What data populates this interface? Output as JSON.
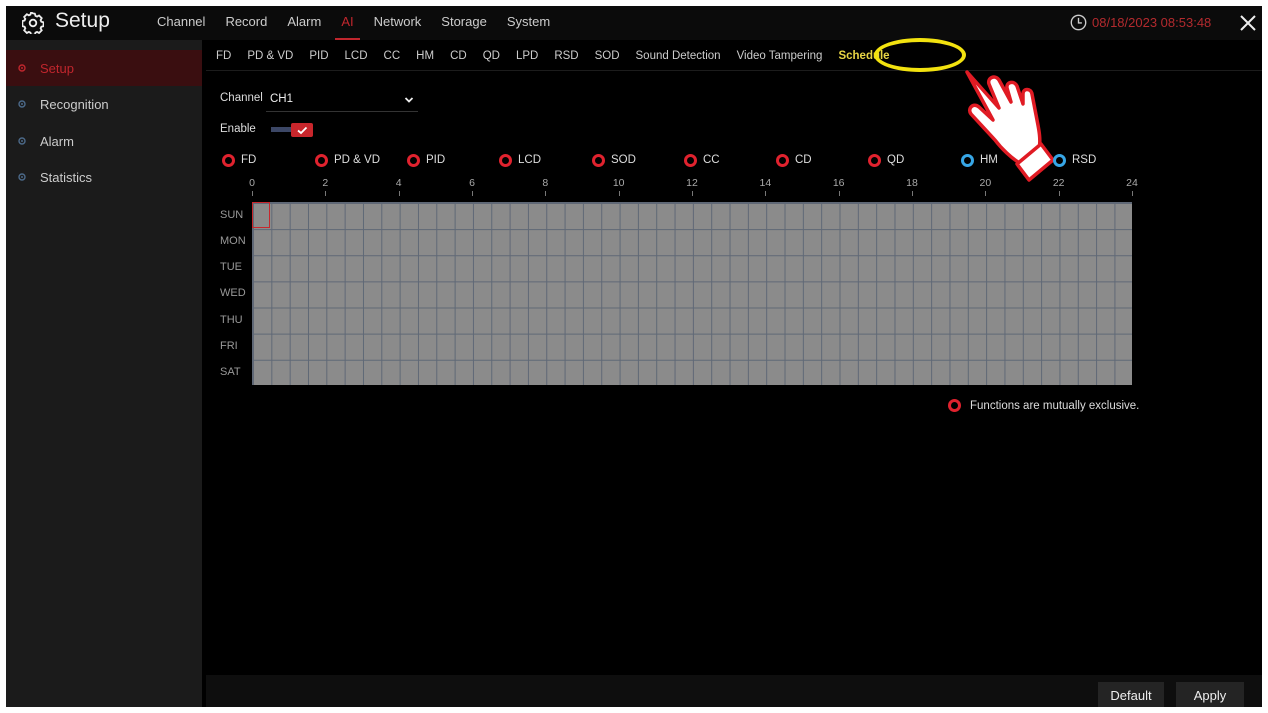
{
  "header": {
    "title": "Setup",
    "datetime": "08/18/2023 08:53:48",
    "icon": "gear-icon",
    "clock_icon": "clock-icon",
    "close_icon": "close-icon"
  },
  "topnav": [
    {
      "label": "Channel",
      "active": false
    },
    {
      "label": "Record",
      "active": false
    },
    {
      "label": "Alarm",
      "active": false
    },
    {
      "label": "AI",
      "active": true
    },
    {
      "label": "Network",
      "active": false
    },
    {
      "label": "Storage",
      "active": false
    },
    {
      "label": "System",
      "active": false
    }
  ],
  "sidebar": [
    {
      "label": "Setup",
      "active": true
    },
    {
      "label": "Recognition",
      "active": false
    },
    {
      "label": "Alarm",
      "active": false
    },
    {
      "label": "Statistics",
      "active": false
    }
  ],
  "subnav": [
    {
      "label": "FD",
      "active": false
    },
    {
      "label": "PD & VD",
      "active": false
    },
    {
      "label": "PID",
      "active": false
    },
    {
      "label": "LCD",
      "active": false
    },
    {
      "label": "CC",
      "active": false
    },
    {
      "label": "HM",
      "active": false
    },
    {
      "label": "CD",
      "active": false
    },
    {
      "label": "QD",
      "active": false
    },
    {
      "label": "LPD",
      "active": false
    },
    {
      "label": "RSD",
      "active": false
    },
    {
      "label": "SOD",
      "active": false
    },
    {
      "label": "Sound Detection",
      "active": false
    },
    {
      "label": "Video Tampering",
      "active": false
    },
    {
      "label": "Schedule",
      "active": true
    }
  ],
  "form": {
    "channel_label": "Channel",
    "channel_value": "CH1",
    "enable_label": "Enable",
    "enable_on": true
  },
  "functions": [
    {
      "label": "FD",
      "color": "#e0222e"
    },
    {
      "label": "PD & VD",
      "color": "#e0222e"
    },
    {
      "label": "PID",
      "color": "#e0222e"
    },
    {
      "label": "LCD",
      "color": "#e0222e"
    },
    {
      "label": "SOD",
      "color": "#e0222e"
    },
    {
      "label": "CC",
      "color": "#e0222e"
    },
    {
      "label": "CD",
      "color": "#e0222e"
    },
    {
      "label": "QD",
      "color": "#e0222e"
    },
    {
      "label": "HM",
      "color": "#37a6e6"
    },
    {
      "label": "RSD",
      "color": "#37a6e6"
    }
  ],
  "schedule": {
    "hour_labels": [
      "0",
      "2",
      "4",
      "6",
      "8",
      "10",
      "12",
      "14",
      "16",
      "18",
      "20",
      "22",
      "24"
    ],
    "days": [
      "SUN",
      "MON",
      "TUE",
      "WED",
      "THU",
      "FRI",
      "SAT"
    ]
  },
  "note": "Functions are mutually exclusive.",
  "buttons": {
    "default": "Default",
    "apply": "Apply"
  }
}
